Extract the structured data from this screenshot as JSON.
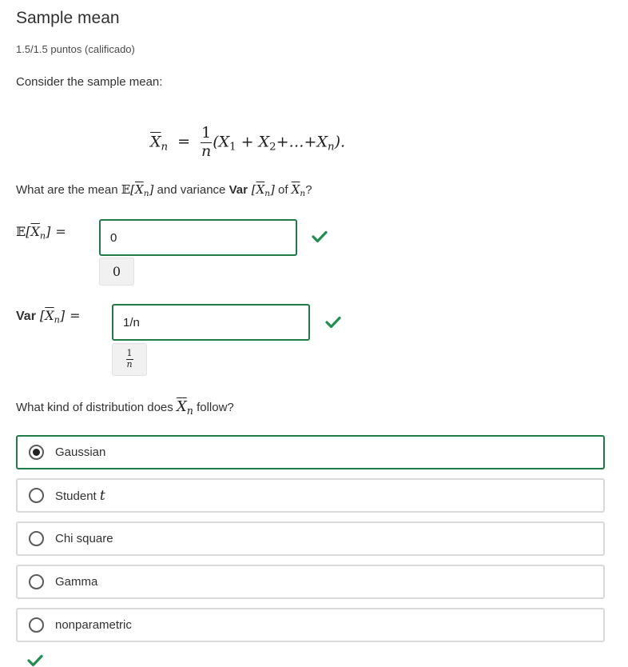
{
  "header": {
    "title": "Sample mean",
    "grade": "1.5/1.5 puntos (calificado)"
  },
  "intro": "Consider the sample mean:",
  "formula": {
    "lhs": "X",
    "lhs_sub": "n",
    "eq": "=",
    "frac_num": "1",
    "frac_den": "n",
    "rhs_open": "(X",
    "rhs_sub1": "1",
    "rhs_plus": " + X",
    "rhs_sub2": "2",
    "rhs_dots": "+…+X",
    "rhs_subn": "n",
    "rhs_close": ")."
  },
  "question1": {
    "pre": "What are the mean ",
    "E": "𝔼",
    "mid": " and variance ",
    "Var": "Var",
    "of": " of ",
    "post": "?"
  },
  "expectation": {
    "label_E": "𝔼",
    "eq": "=",
    "input_value": "0",
    "preview": "0",
    "correct": true
  },
  "variance": {
    "label_Var": "Var",
    "eq": "=",
    "input_value": "1/n",
    "preview_num": "1",
    "preview_den": "n",
    "correct": true
  },
  "question2": {
    "pre": "What kind of distribution does ",
    "post": " follow?"
  },
  "options": [
    {
      "label": "Gaussian",
      "selected": true
    },
    {
      "label": "Student ",
      "extra": "t",
      "selected": false
    },
    {
      "label": "Chi square",
      "selected": false
    },
    {
      "label": "Gamma",
      "selected": false
    },
    {
      "label": "nonparametric",
      "selected": false
    }
  ],
  "colors": {
    "correct": "#1f7a47",
    "check": "#1e8f4e"
  },
  "icons": {
    "correct": "checkmark-icon"
  }
}
